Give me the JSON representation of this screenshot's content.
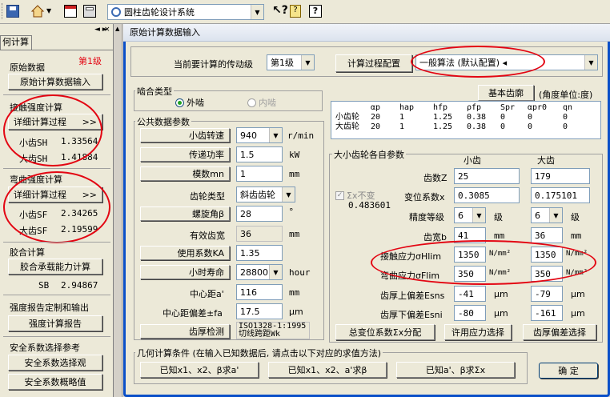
{
  "toolbar": {
    "system_combo": "圆柱齿轮设计系统"
  },
  "left_panel": {
    "tab": "何计算",
    "level_badge": "第1级",
    "sections": {
      "original": {
        "title": "原始数据",
        "button": "原始计算数据输入"
      },
      "contact": {
        "title": "接触强度计算",
        "button": "详细计算过程",
        "button_arrow": ">>",
        "sh1_label": "小齿SH",
        "sh1_value": "1.33564",
        "sh2_label": "大齿SH",
        "sh2_value": "1.41884"
      },
      "bending": {
        "title": "弯曲强度计算",
        "button": "详细计算过程",
        "button_arrow": ">>",
        "sf1_label": "小齿SF",
        "sf1_value": "2.34265",
        "sf2_label": "大齿SF",
        "sf2_value": "2.19599"
      },
      "glue": {
        "title": "胶合计算",
        "button": "胶合承载能力计算",
        "sb_label": "SB",
        "sb_value": "2.94867"
      },
      "report": {
        "title": "强度报告定制和输出",
        "button": "强度计算报告"
      },
      "safety": {
        "title": "安全系数选择参考",
        "button1": "安全系数选择观",
        "button2": "安全系数概略值"
      }
    }
  },
  "dialog": {
    "title": "原始计算数据输入",
    "current_stage_label": "当前要计算的传动级",
    "current_stage_value": "第1级",
    "config_button": "计算过程配置",
    "method_value": "一般算法 (默认配置)",
    "mesh": {
      "title": "啮合类型",
      "opt_external": "外啮",
      "opt_internal": "内啮"
    },
    "basic_profile_button": "基本齿廓",
    "angle_unit": "(角度单位:度)",
    "profile_table": {
      "headers": [
        "αp",
        "hap",
        "hfp",
        "ρfp",
        "Spr",
        "αpr0",
        "qn"
      ],
      "rows": [
        {
          "label": "小齿轮",
          "values": [
            "20",
            "1",
            "1.25",
            "0.38",
            "0",
            "0",
            "0"
          ]
        },
        {
          "label": "大齿轮",
          "values": [
            "20",
            "1",
            "1.25",
            "0.38",
            "0",
            "0",
            "0"
          ]
        }
      ]
    },
    "common": {
      "title": "公共数据参数",
      "speed": {
        "label": "小齿转速",
        "value": "940",
        "unit": "r/min"
      },
      "power": {
        "label": "传递功率",
        "value": "1.5",
        "unit": "kW"
      },
      "module": {
        "label": "模数mn",
        "value": "1",
        "unit": "mm"
      },
      "gear_type": {
        "label": "齿轮类型",
        "value": "斜齿齿轮"
      },
      "helix": {
        "label": "螺旋角β",
        "value": "28",
        "unit": "°"
      },
      "face_width": {
        "label": "有效齿宽",
        "value": "36",
        "unit": "mm"
      },
      "ka": {
        "label": "使用系数KA",
        "value": "1.35"
      },
      "life": {
        "label": "小时寿命",
        "value": "28800",
        "unit": "hour"
      },
      "center": {
        "label": "中心距a'",
        "value": "116",
        "unit": "mm"
      },
      "center_dev": {
        "label": "中心距偏差±fa",
        "value": "17.5",
        "unit": "μm"
      },
      "check": {
        "label": "齿厚检测",
        "value1": "ISO1328-1:1995",
        "value2": "切线跨距Wk"
      }
    },
    "params": {
      "title": "大小齿轮各自参数",
      "col_small": "小齿",
      "col_large": "大齿",
      "sigma_label": "Σx不变",
      "sigma_value": "0.483601",
      "rows": {
        "teeth": {
          "label": "齿数Z",
          "small": "25",
          "large": "179"
        },
        "shift": {
          "label": "变位系数x",
          "small": "0.3085",
          "large": "0.175101"
        },
        "grade": {
          "label": "精度等级",
          "small": "6",
          "large": "6",
          "unit": "级"
        },
        "width": {
          "label": "齿宽b",
          "small": "41",
          "large": "36",
          "unit": "mm"
        },
        "hlim": {
          "label": "接触应力σHlim",
          "small": "1350",
          "large": "1350",
          "unit": "N/mm²"
        },
        "flim": {
          "label": "弯曲应力σFlim",
          "small": "350",
          "large": "350",
          "unit": "N/mm²"
        },
        "esns": {
          "label": "齿厚上偏差Esns",
          "small": "-41",
          "large": "-79",
          "unit": "μm"
        },
        "esni": {
          "label": "齿厚下偏差Esni",
          "small": "-80",
          "large": "-161",
          "unit": "μm"
        }
      },
      "btn_total_shift": "总变位系数Σx分配",
      "btn_allow_stress": "许用应力选择",
      "btn_thickness": "齿厚偏差选择"
    },
    "geometry": {
      "title": "几何计算条件 (在输入已知数据后, 请点击以下对应的求值方法)",
      "btn1": "已知x1、x2、β求a'",
      "btn2": "已知x1、x2、a'求β",
      "btn3": "已知a'、β求Σx"
    },
    "ok_button": "确 定"
  }
}
